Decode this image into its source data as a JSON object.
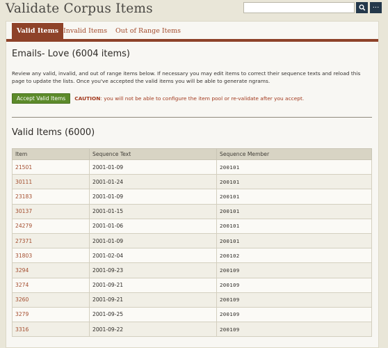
{
  "header": {
    "title": "Validate Corpus Items",
    "search": {
      "value": "",
      "placeholder": ""
    },
    "search_icon": "search-icon",
    "more_label": "···"
  },
  "tabs": [
    {
      "label": "Valid Items",
      "active": true
    },
    {
      "label": "Invalid Items",
      "active": false
    },
    {
      "label": "Out of Range Items",
      "active": false
    }
  ],
  "corpus": {
    "title": "Emails- Love (6004 items)",
    "intro": "Review any valid, invalid, and out of range items below. If necessary you may edit items to correct their sequence texts and reload this page to update the lists. Once you've accepted the valid items you will be able to generate ngrams.",
    "accept_label": "Accept Valid Items",
    "caution_label": "CAUTION",
    "caution_text": ": you will not be able to configure the item pool or re-validate after you accept."
  },
  "valid_section": {
    "title": "Valid Items (6000)",
    "columns": [
      "Item",
      "Sequence Text",
      "Sequence Member"
    ],
    "rows": [
      {
        "item": "21501",
        "sequence_text": "2001-01-09",
        "sequence_member": "200101"
      },
      {
        "item": "30111",
        "sequence_text": "2001-01-24",
        "sequence_member": "200101"
      },
      {
        "item": "23183",
        "sequence_text": "2001-01-09",
        "sequence_member": "200101"
      },
      {
        "item": "30137",
        "sequence_text": "2001-01-15",
        "sequence_member": "200101"
      },
      {
        "item": "24279",
        "sequence_text": "2001-01-06",
        "sequence_member": "200101"
      },
      {
        "item": "27371",
        "sequence_text": "2001-01-09",
        "sequence_member": "200101"
      },
      {
        "item": "31803",
        "sequence_text": "2001-02-04",
        "sequence_member": "200102"
      },
      {
        "item": "3294",
        "sequence_text": "2001-09-23",
        "sequence_member": "200109"
      },
      {
        "item": "3274",
        "sequence_text": "2001-09-21",
        "sequence_member": "200109"
      },
      {
        "item": "3260",
        "sequence_text": "2001-09-21",
        "sequence_member": "200109"
      },
      {
        "item": "3279",
        "sequence_text": "2001-09-25",
        "sequence_member": "200109"
      },
      {
        "item": "3316",
        "sequence_text": "2001-09-22",
        "sequence_member": "200109"
      }
    ]
  },
  "colors": {
    "accent": "#8e4229",
    "link": "#a34c2d",
    "accept": "#5c8a2a",
    "search_button": "#24384b",
    "background": "#e9e6d8"
  }
}
